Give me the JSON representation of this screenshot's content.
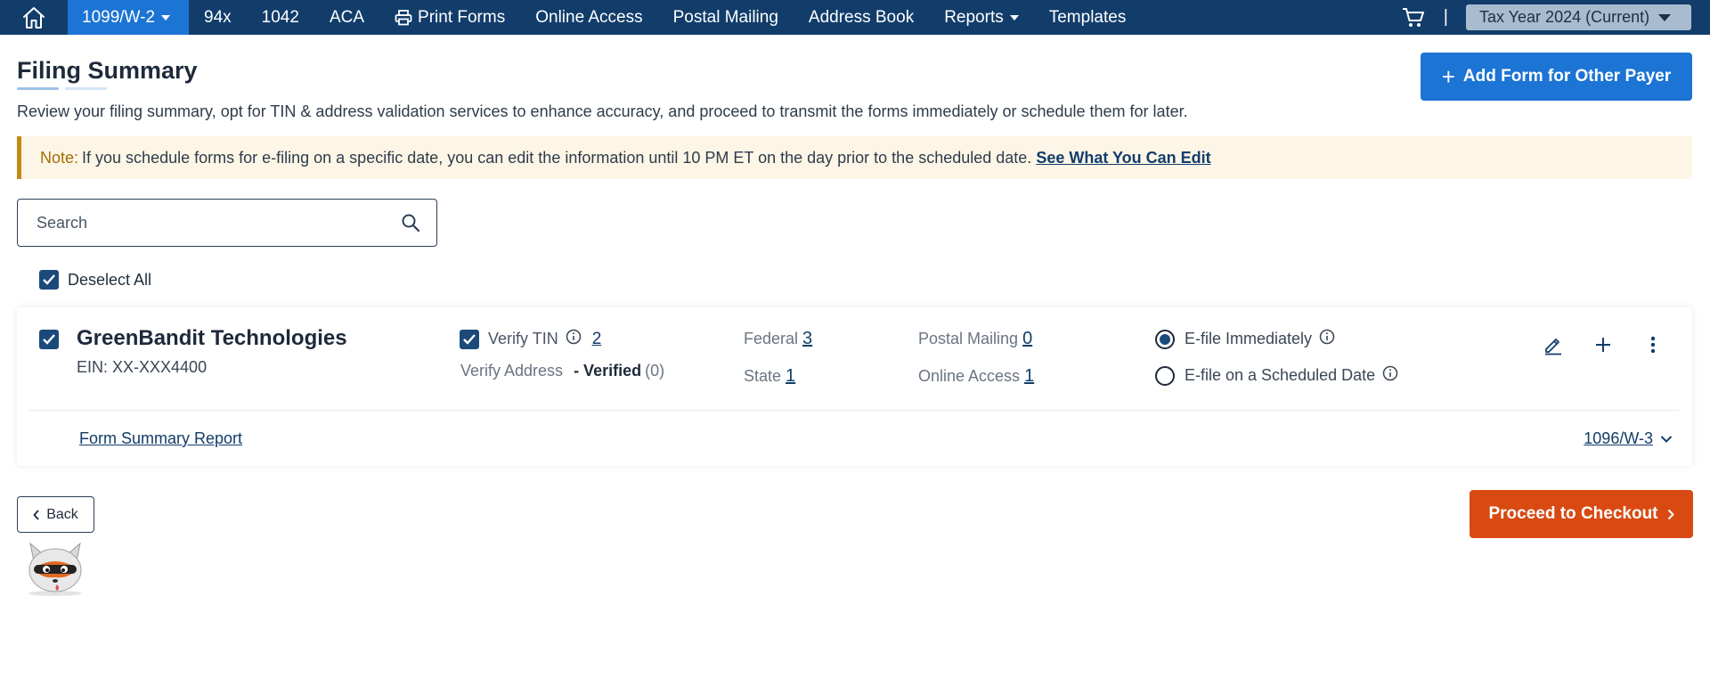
{
  "nav": {
    "items": [
      {
        "label": "1099/W-2",
        "dropdown": true
      },
      {
        "label": "94x"
      },
      {
        "label": "1042"
      },
      {
        "label": "ACA"
      },
      {
        "label": "Print Forms",
        "icon": "printer-icon"
      },
      {
        "label": "Online Access"
      },
      {
        "label": "Postal Mailing"
      },
      {
        "label": "Address Book"
      },
      {
        "label": "Reports",
        "dropdown": true
      },
      {
        "label": "Templates"
      }
    ],
    "separator": "|",
    "tax_year": "Tax Year 2024 (Current)"
  },
  "header": {
    "title": "Filing Summary",
    "add_form_label": "Add Form for Other Payer",
    "subtitle": "Review your filing summary, opt for TIN & address validation services to enhance accuracy, and proceed to transmit the forms immediately or schedule them for later."
  },
  "note": {
    "label": "Note:",
    "text": "If you schedule forms for e-filing on a specific date, you can edit the information until 10 PM ET on the day prior to the scheduled date.",
    "link": "See What You Can Edit"
  },
  "search": {
    "placeholder": "Search"
  },
  "deselect_label": "Deselect All",
  "payer": {
    "name": "GreenBandit Technologies",
    "ein": "EIN: XX-XXX4400",
    "verify_tin_label": "Verify TIN",
    "verify_tin_count": "2",
    "verify_address_label": "Verify Address",
    "verify_address_status": "- Verified",
    "verify_address_count": "(0)",
    "federal_label": "Federal",
    "federal_count": "3",
    "state_label": "State",
    "state_count": "1",
    "postal_label": "Postal Mailing",
    "postal_count": "0",
    "online_label": "Online Access",
    "online_count": "1",
    "efile_immediately": "E-file Immediately",
    "efile_scheduled": "E-file on a Scheduled Date",
    "form_summary_report": "Form Summary Report",
    "transmittal": "1096/W-3"
  },
  "footer": {
    "back_label": "Back",
    "checkout_label": "Proceed to Checkout"
  },
  "colors": {
    "nav_bg": "#123d6b",
    "accent": "#1c74d4",
    "checkout": "#d84a12",
    "note_border": "#c18a14"
  }
}
